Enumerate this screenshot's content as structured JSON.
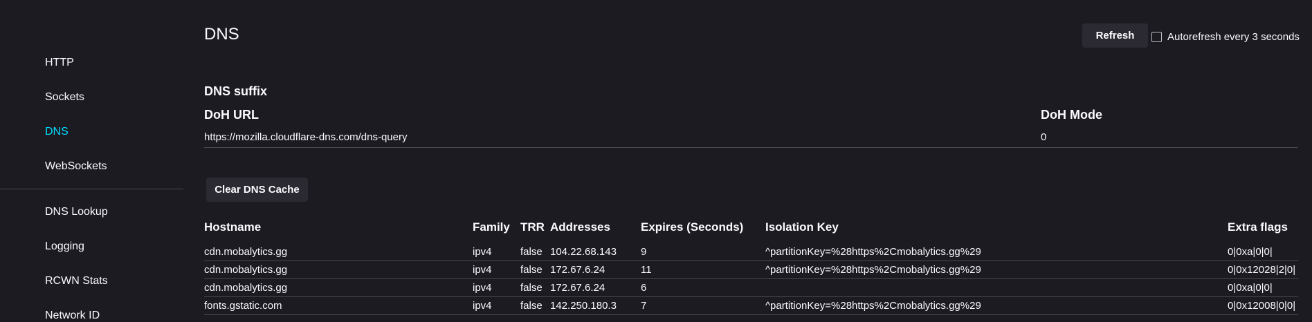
{
  "sidebar": {
    "items": [
      {
        "label": "HTTP"
      },
      {
        "label": "Sockets"
      },
      {
        "label": "DNS"
      },
      {
        "label": "WebSockets"
      },
      {
        "label": "DNS Lookup"
      },
      {
        "label": "Logging"
      },
      {
        "label": "RCWN Stats"
      },
      {
        "label": "Network ID"
      }
    ],
    "active_index": 2
  },
  "header": {
    "title": "DNS",
    "refresh_label": "Refresh",
    "autorefresh_label": "Autorefresh every 3 seconds",
    "autorefresh_checked": false
  },
  "dns_suffix": {
    "heading": "DNS suffix"
  },
  "doh": {
    "url_heading": "DoH URL",
    "mode_heading": "DoH Mode",
    "url_value": "https://mozilla.cloudflare-dns.com/dns-query",
    "mode_value": "0"
  },
  "clear_cache_label": "Clear DNS Cache",
  "table": {
    "columns": [
      "Hostname",
      "Family",
      "TRR",
      "Addresses",
      "Expires (Seconds)",
      "Isolation Key",
      "Extra flags"
    ],
    "rows": [
      [
        "cdn.mobalytics.gg",
        "ipv4",
        "false",
        "104.22.68.143",
        "9",
        "^partitionKey=%28https%2Cmobalytics.gg%29",
        "0|0xa|0|0|"
      ],
      [
        "cdn.mobalytics.gg",
        "ipv4",
        "false",
        "172.67.6.24",
        "11",
        "^partitionKey=%28https%2Cmobalytics.gg%29",
        "0|0x12028|2|0|"
      ],
      [
        "cdn.mobalytics.gg",
        "ipv4",
        "false",
        "172.67.6.24",
        "6",
        "",
        "0|0xa|0|0|"
      ],
      [
        "fonts.gstatic.com",
        "ipv4",
        "false",
        "142.250.180.3",
        "7",
        "^partitionKey=%28https%2Cmobalytics.gg%29",
        "0|0x12008|0|0|"
      ]
    ]
  },
  "colors": {
    "background": "#1c1b22",
    "text": "#fbfbfe",
    "accent": "#00ddff",
    "button_bg": "#2b2a33",
    "divider": "#4a4950"
  }
}
